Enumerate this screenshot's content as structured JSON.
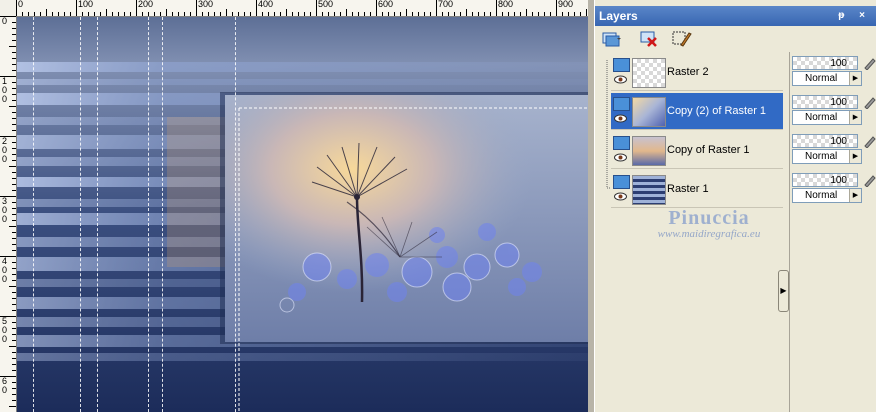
{
  "ruler": {
    "top_labels": [
      "0",
      "100",
      "200",
      "300",
      "400",
      "500",
      "600",
      "700",
      "800",
      "900"
    ],
    "left_digits": [
      "0",
      "1",
      "0",
      "0",
      "2",
      "0",
      "0",
      "3",
      "0",
      "0",
      "4",
      "0",
      "0",
      "5",
      "0",
      "0",
      "6",
      "0"
    ]
  },
  "palette": {
    "title": "Layers",
    "title_icons": "ᵽ ×",
    "toolbar": {
      "new_layer_icon": "new-layer-icon",
      "delete_layer_icon": "delete-layer-icon",
      "edit_icon": "edit-selection-icon"
    },
    "layers": [
      {
        "name": "Raster 2",
        "opacity": "100",
        "blend": "Normal",
        "selected": false
      },
      {
        "name": "Copy (2) of Raster 1",
        "opacity": "100",
        "blend": "Normal",
        "selected": true
      },
      {
        "name": "Copy of Raster 1",
        "opacity": "100",
        "blend": "Normal",
        "selected": false
      },
      {
        "name": "Raster 1",
        "opacity": "100",
        "blend": "Normal",
        "selected": false
      }
    ]
  },
  "watermark": {
    "name": "Pinuccia",
    "url": "www.maidiregrafica.eu"
  }
}
